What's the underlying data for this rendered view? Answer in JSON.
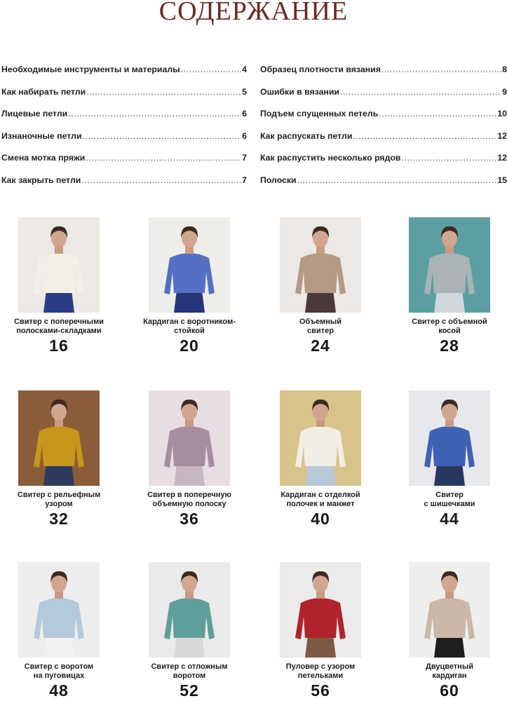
{
  "title": "СОДЕРЖАНИЕ",
  "toc_left": [
    {
      "title": "Необходимые инструменты и материалы",
      "page": "4"
    },
    {
      "title": "Как набирать петли",
      "page": "5"
    },
    {
      "title": "Лицевые петли",
      "page": "6"
    },
    {
      "title": "Изнаночные петли",
      "page": "6"
    },
    {
      "title": "Смена мотка пряжи",
      "page": "7"
    },
    {
      "title": "Как закрыть петли",
      "page": "7"
    }
  ],
  "toc_right": [
    {
      "title": "Образец плотности вязания",
      "page": "8"
    },
    {
      "title": "Ошибки в вязании",
      "page": "9"
    },
    {
      "title": "Подъем спущенных петель",
      "page": "10"
    },
    {
      "title": "Как распускать петли",
      "page": "12"
    },
    {
      "title": "Как распустить несколько рядов",
      "page": "12"
    },
    {
      "title": "Полоски",
      "page": "15"
    }
  ],
  "projects": [
    {
      "title": "Свитер с поперечными\nполосками-складками",
      "page": "16",
      "bg": "#ece8e4",
      "garment": "#f3efe6",
      "pants": "#2c3b86"
    },
    {
      "title": "Кардиган с воротником-\nстойкой",
      "page": "20",
      "bg": "#efedea",
      "garment": "#5470c4",
      "pants": "#27347a"
    },
    {
      "title": "Объемный\nсвитер",
      "page": "24",
      "bg": "#ece9e4",
      "garment": "#b39a84",
      "pants": "#4b3a38"
    },
    {
      "title": "Свитер с объемной\nкосой",
      "page": "28",
      "bg": "#5c9fa2",
      "garment": "#aab4b6",
      "pants": "#cfd8de"
    },
    {
      "title": "Свитер с рельефным\nузором",
      "page": "32",
      "bg": "#8a5c38",
      "garment": "#c8961a",
      "pants": "#2f3b5e"
    },
    {
      "title": "Свитер в поперечную\nобъемную полоску",
      "page": "36",
      "bg": "#e9dde4",
      "garment": "#a58ea0",
      "pants": "#c7b7c0"
    },
    {
      "title": "Кардиган с отделкой\nполочек и манжет",
      "page": "40",
      "bg": "#d8c38a",
      "garment": "#f2eee6",
      "pants": "#b7c8d8"
    },
    {
      "title": "Свитер\nс шишечками",
      "page": "44",
      "bg": "#e7e8ec",
      "garment": "#3e63b3",
      "pants": "#27375f"
    },
    {
      "title": "Свитер с воротом\nна пуговицах",
      "page": "48",
      "bg": "#ededed",
      "garment": "#b4c9da",
      "pants": "#f1f1f1"
    },
    {
      "title": "Свитер с отложным\nворотом",
      "page": "52",
      "bg": "#eaeaea",
      "garment": "#5f9e9b",
      "pants": "#d8d8d8"
    },
    {
      "title": "Пуловер с узором\nпетельками",
      "page": "56",
      "bg": "#ebebeb",
      "garment": "#b0232d",
      "pants": "#7c5a46"
    },
    {
      "title": "Двуцветный\nкардиган",
      "page": "60",
      "bg": "#eeeeec",
      "garment": "#cbb8a8",
      "pants": "#1e1e1e"
    }
  ]
}
